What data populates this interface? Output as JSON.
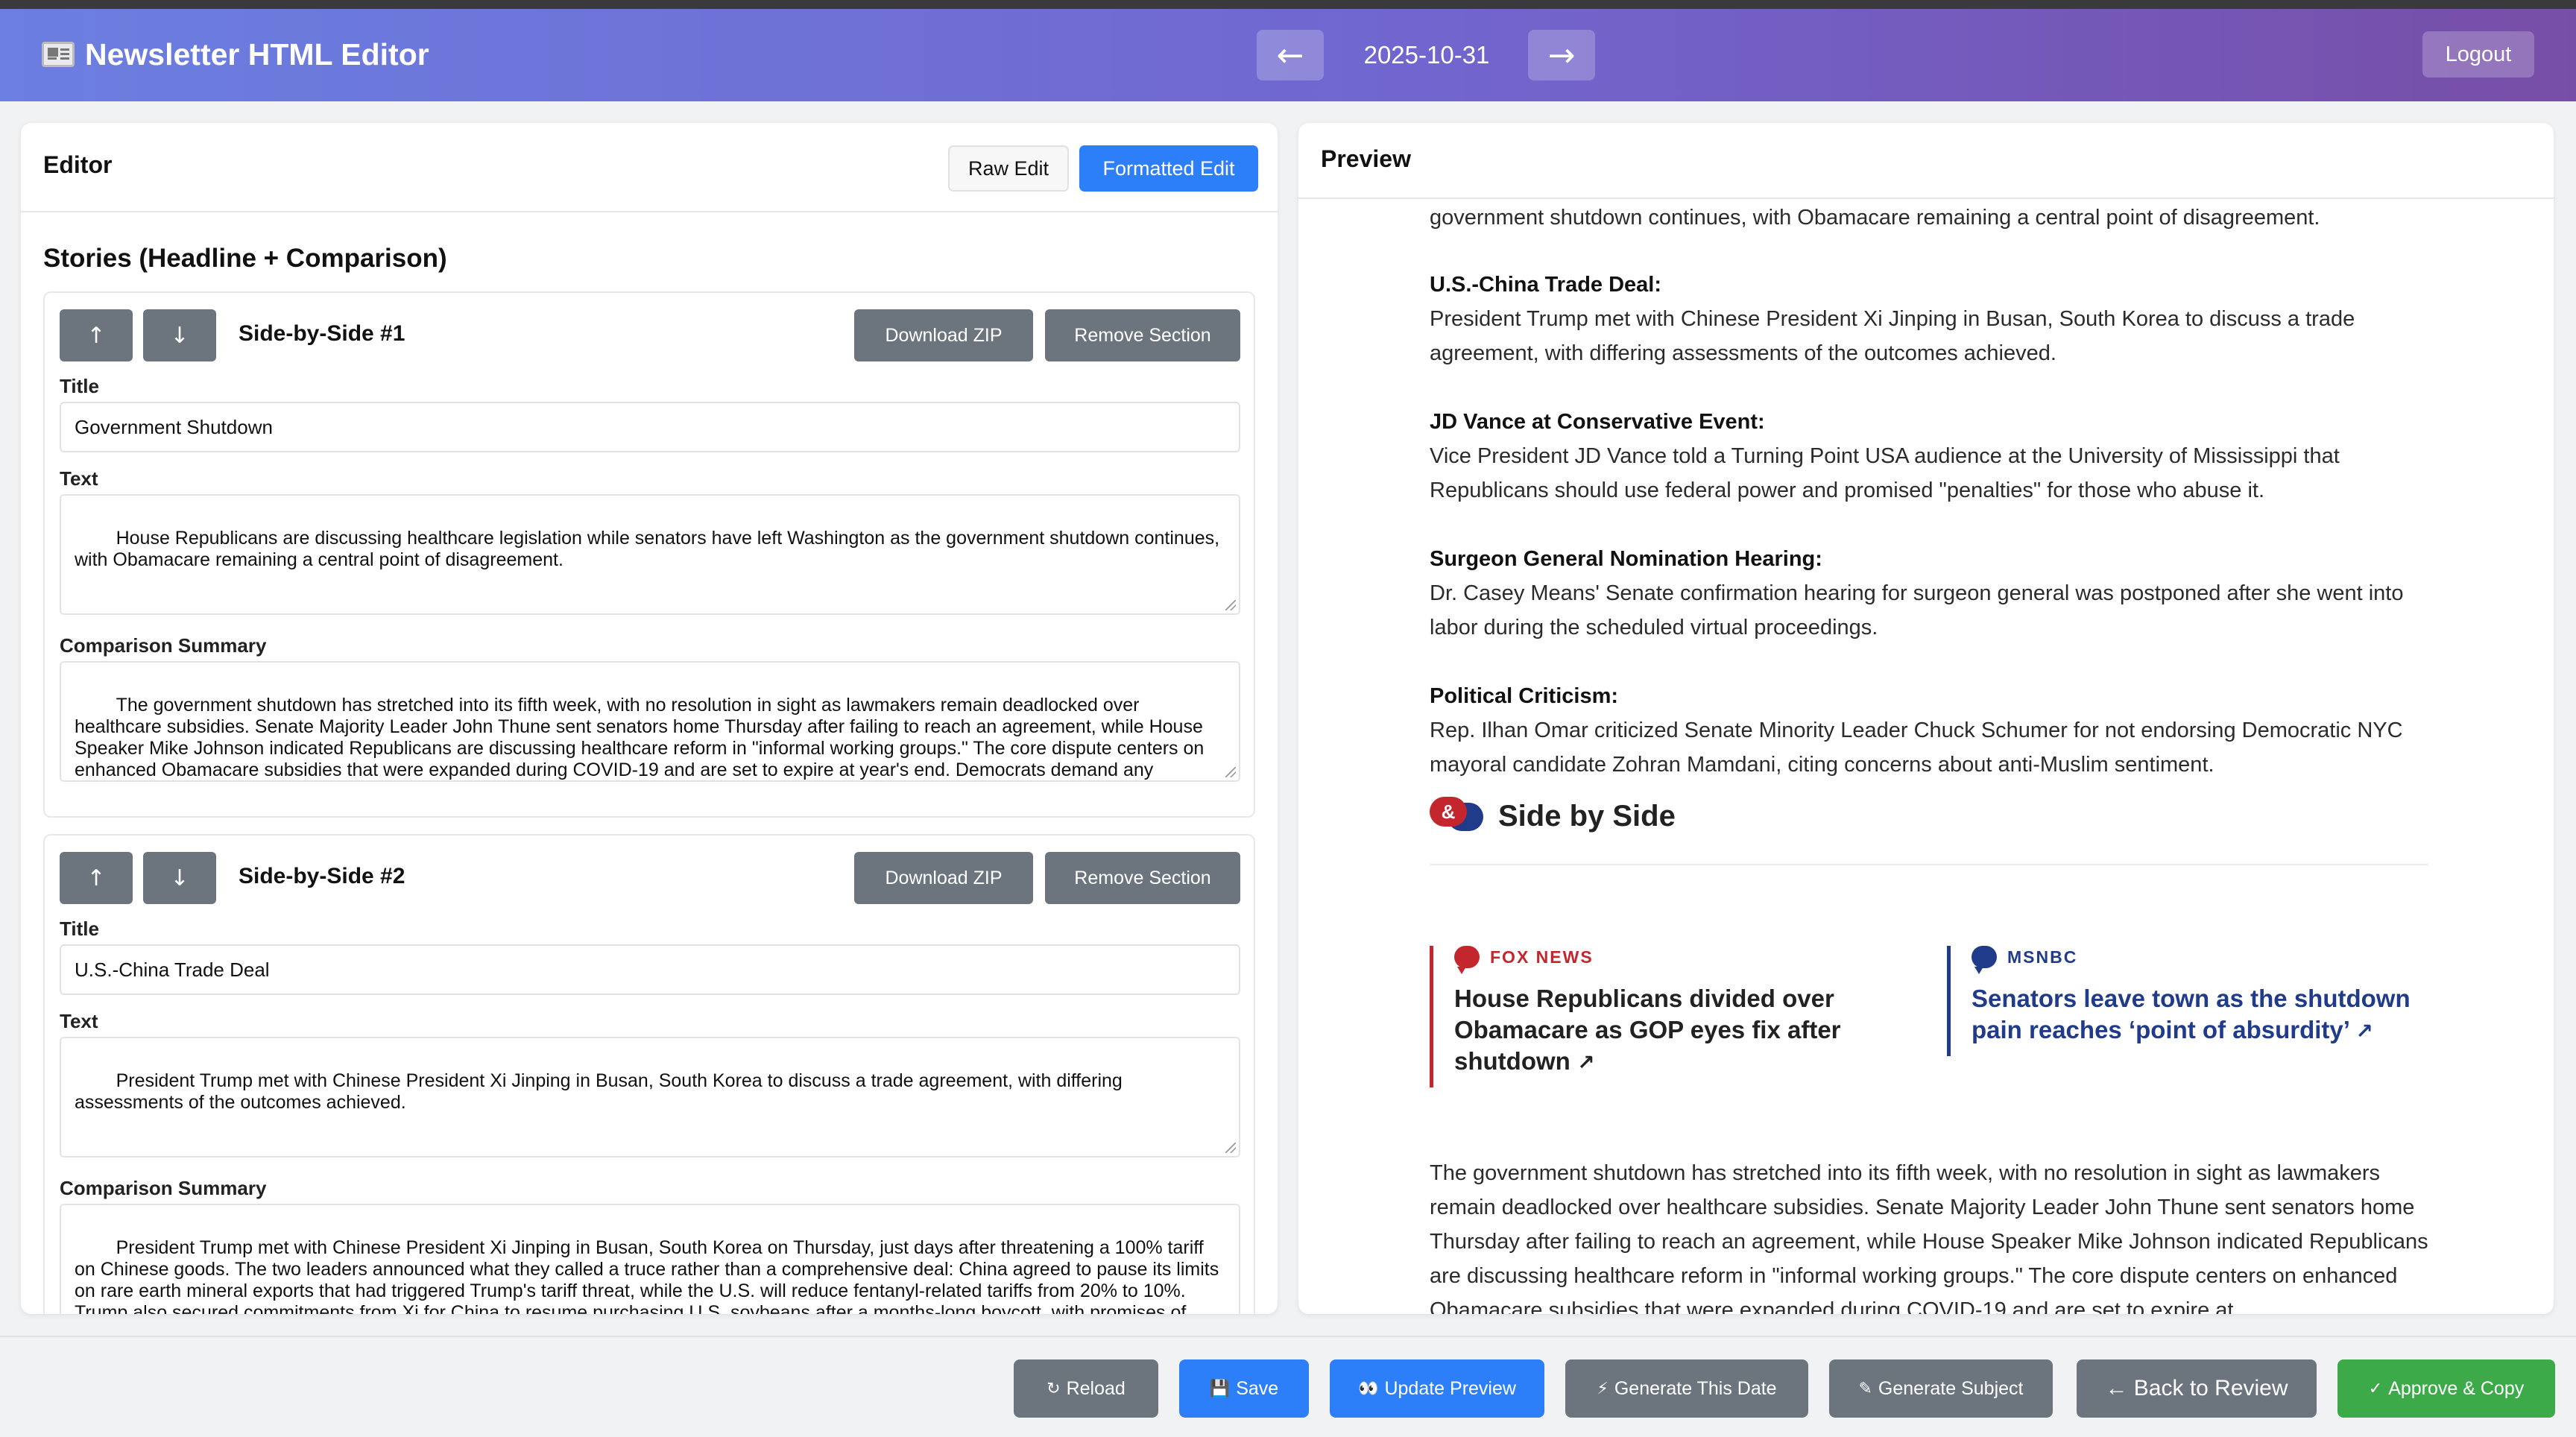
{
  "header": {
    "title": "Newsletter HTML Editor",
    "prev_label": "←",
    "date": "2025-10-31",
    "next_label": "→",
    "logout_label": "Logout"
  },
  "editor": {
    "title": "Editor",
    "raw_edit_label": "Raw Edit",
    "formatted_edit_label": "Formatted Edit",
    "stories_heading": "Stories (Headline + Comparison)",
    "move_up_label": "↑",
    "move_down_label": "↓",
    "download_zip_label": "Download ZIP",
    "remove_section_label": "Remove Section",
    "title_field_label": "Title",
    "text_field_label": "Text",
    "comparison_field_label": "Comparison Summary",
    "sections": [
      {
        "label": "Side-by-Side #1",
        "title": "Government Shutdown",
        "text": "House Republicans are discussing healthcare legislation while senators have left Washington as the government shutdown continues, with Obamacare remaining a central point of disagreement.",
        "comparison": "The government shutdown has stretched into its fifth week, with no resolution in sight as lawmakers remain deadlocked over healthcare subsidies. Senate Majority Leader John Thune sent senators home Thursday after failing to reach an agreement, while House Speaker Mike Johnson indicated Republicans are discussing healthcare reform in \"informal working groups.\" The core dispute centers on enhanced Obamacare subsidies that were expanded during COVID-19 and are set to expire at year's end. Democrats demand any shutdown deal include extending these tax credits, while Republicans want to keep the issues separate. Within the GOP,"
      },
      {
        "label": "Side-by-Side #2",
        "title": "U.S.-China Trade Deal",
        "text": "President Trump met with Chinese President Xi Jinping in Busan, South Korea to discuss a trade agreement, with differing assessments of the outcomes achieved.",
        "comparison": "President Trump met with Chinese President Xi Jinping in Busan, South Korea on Thursday, just days after threatening a 100% tariff on Chinese goods. The two leaders announced what they called a truce rather than a comprehensive deal: China agreed to pause its limits on rare earth mineral exports that had triggered Trump's tariff threat, while the U.S. will reduce fentanyl-related tariffs from 20% to 10%. Trump also secured commitments from Xi for China to resume purchasing U.S. soybeans after a months-long boycott, with promises of \"massive\" future purchases. Beyond the China meeting, Trump's broader Asia trip included signing critical mineral"
      }
    ]
  },
  "preview": {
    "title": "Preview",
    "top_text": "government shutdown continues, with Obamacare remaining a central point of disagreement.",
    "items": [
      {
        "headline": "U.S.-China Trade Deal:",
        "body": "President Trump met with Chinese President Xi Jinping in Busan, South Korea to discuss a trade agreement, with differing assessments of the outcomes achieved."
      },
      {
        "headline": "JD Vance at Conservative Event:",
        "body": "Vice President JD Vance told a Turning Point USA audience at the University of Mississippi that Republicans should use federal power and promised \"penalties\" for those who abuse it."
      },
      {
        "headline": "Surgeon General Nomination Hearing:",
        "body": "Dr. Casey Means' Senate confirmation hearing for surgeon general was postponed after she went into labor during the scheduled virtual proceedings."
      },
      {
        "headline": "Political Criticism:",
        "body": "Rep. Ilhan Omar criticized Senate Minority Leader Chuck Schumer for not endorsing Democratic NYC mayoral candidate Zohran Mamdani, citing concerns about anti-Muslim sentiment."
      }
    ],
    "sbs_icon_glyph": "&",
    "sbs_title": "Side by Side",
    "sources": [
      {
        "name": "FOX NEWS",
        "headline": "House Republicans divided over Obamacare as GOP eyes fix after shutdown",
        "color": "#c4262e"
      },
      {
        "name": "MSNBC",
        "headline": "Senators leave town as the shutdown pain reaches ‘point of absurdity’",
        "color": "#1f3b8a"
      }
    ],
    "external_link_glyph": "↗",
    "summary": "The government shutdown has stretched into its fifth week, with no resolution in sight as lawmakers remain deadlocked over healthcare subsidies. Senate Majority Leader John Thune sent senators home Thursday after failing to reach an agreement, while House Speaker Mike Johnson indicated Republicans are discussing healthcare reform in \"informal working groups.\" The core dispute centers on enhanced Obamacare subsidies that were expanded during COVID-19 and are set to expire at"
  },
  "footer": {
    "reload_icon": "↻",
    "reload_label": "Reload",
    "save_icon": "💾",
    "save_label": "Save",
    "update_preview_icon": "👀",
    "update_preview_label": "Update Preview",
    "generate_date_icon": "⚡",
    "generate_date_label": "Generate This Date",
    "generate_subject_icon": "✎",
    "generate_subject_label": "Generate Subject",
    "back_to_review_label": "← Back to Review",
    "approve_icon": "✓",
    "approve_label": "Approve & Copy"
  },
  "colors": {
    "header_start": "#6b7fe0",
    "header_end": "#774ea7",
    "primary": "#2d7ff9",
    "secondary": "#6c757d",
    "success": "#3daa4a",
    "fox": "#c4262e",
    "msnbc": "#1f3b8a"
  }
}
